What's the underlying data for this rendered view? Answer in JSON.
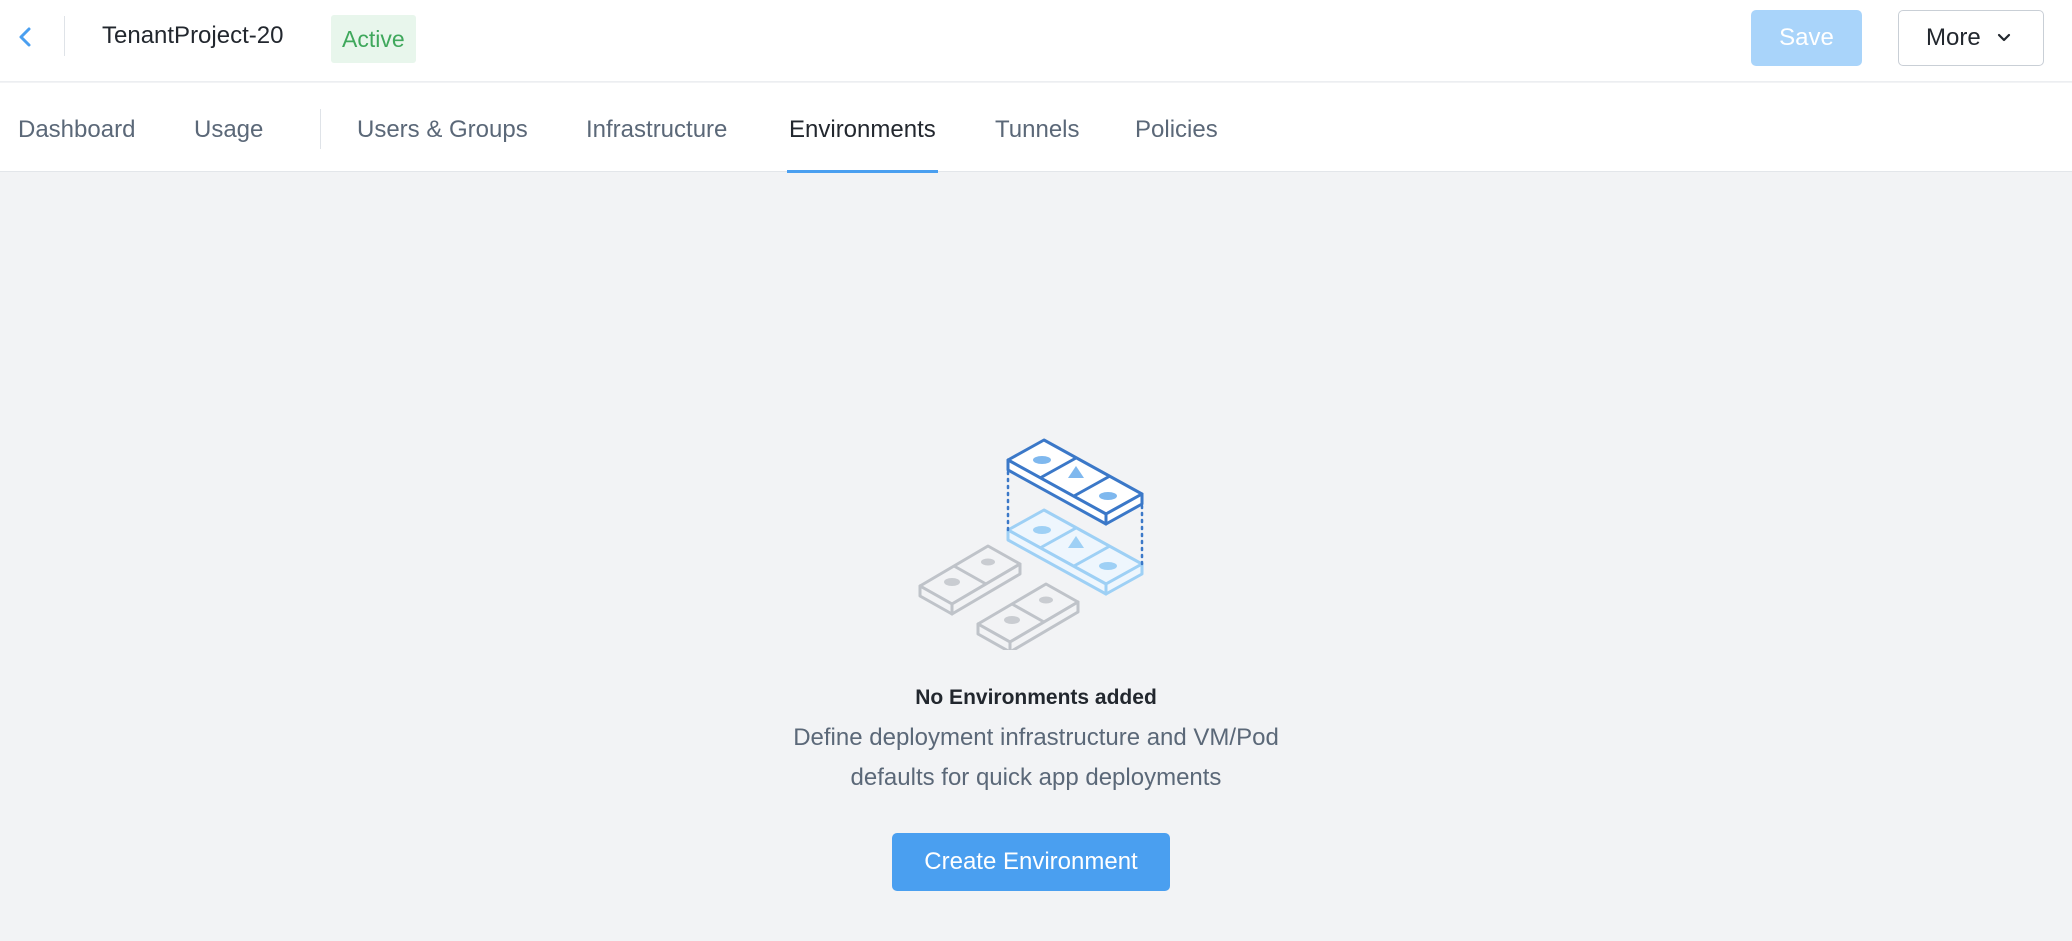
{
  "header": {
    "project_title": "TenantProject-20",
    "status": "Active",
    "save_label": "Save",
    "more_label": "More"
  },
  "tabs": [
    {
      "label": "Dashboard",
      "active": false
    },
    {
      "label": "Usage",
      "active": false
    },
    {
      "label": "Users & Groups",
      "active": false
    },
    {
      "label": "Infrastructure",
      "active": false
    },
    {
      "label": "Environments",
      "active": true
    },
    {
      "label": "Tunnels",
      "active": false
    },
    {
      "label": "Policies",
      "active": false
    }
  ],
  "empty_state": {
    "title": "No Environments added",
    "description_line1": "Define deployment infrastructure and VM/Pod",
    "description_line2": "defaults for quick app deployments",
    "button_label": "Create Environment"
  },
  "icons": {
    "back": "chevron-left-icon",
    "more": "chevron-down-icon",
    "illustration": "environments-stack-illustration"
  },
  "colors": {
    "accent": "#4a9ff0",
    "save_disabled": "#a9d4fa",
    "status_green": "#3fa85c",
    "status_bg": "#e8f6ec",
    "page_bg": "#f2f3f5"
  }
}
